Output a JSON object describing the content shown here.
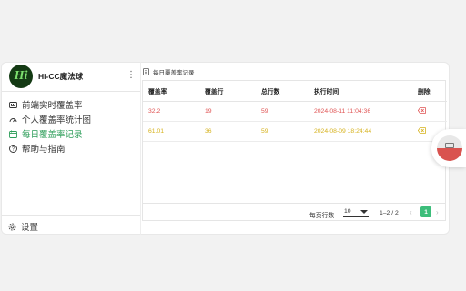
{
  "brand": {
    "logo_text": "Hi",
    "name": "Hi-CC魔法球",
    "menu_icon": "more-vertical-icon"
  },
  "nav": {
    "items": [
      {
        "label": "前端实时覆盖率",
        "icon": "keyboard-icon",
        "active": false
      },
      {
        "label": "个人覆盖率统计图",
        "icon": "gauge-icon",
        "active": false
      },
      {
        "label": "每日覆盖率记录",
        "icon": "calendar-icon",
        "active": true
      },
      {
        "label": "帮助与指南",
        "icon": "help-circle-icon",
        "active": false
      }
    ],
    "settings_label": "设置"
  },
  "main": {
    "title": "每日覆盖率记录",
    "columns": [
      "覆盖率",
      "覆盖行",
      "总行数",
      "执行时间",
      "删除"
    ],
    "rows": [
      {
        "coverage": "32.2",
        "covered": "19",
        "total": "59",
        "time": "2024-08-11 11:04:36",
        "color": "red"
      },
      {
        "coverage": "61.01",
        "covered": "36",
        "total": "59",
        "time": "2024-08-09 18:24:44",
        "color": "yellow"
      }
    ],
    "pagination": {
      "rows_per_page_label": "每页行数",
      "page_size": "10",
      "range": "1–2 / 2",
      "current_page": "1"
    }
  },
  "colors": {
    "accent": "#3cbd7a",
    "active_nav": "#2e9e5a",
    "red": "#e05454",
    "yellow": "#d6b21c"
  }
}
